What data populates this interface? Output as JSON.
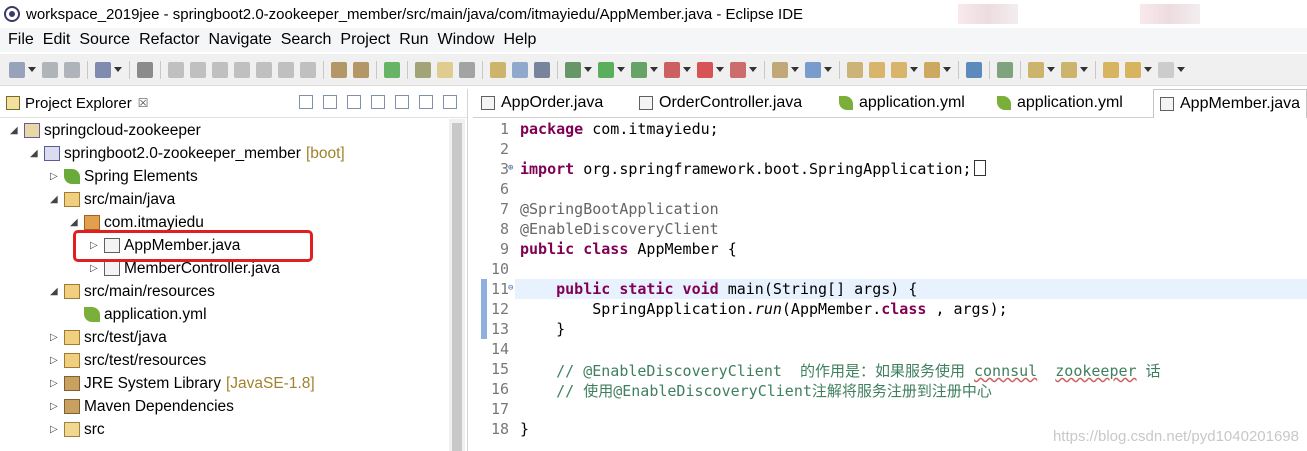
{
  "window": {
    "title": "workspace_2019jee - springboot2.0-zookeeper_member/src/main/java/com/itmayiedu/AppMember.java - Eclipse IDE"
  },
  "menubar": {
    "items": [
      "File",
      "Edit",
      "Source",
      "Refactor",
      "Navigate",
      "Search",
      "Project",
      "Run",
      "Window",
      "Help"
    ]
  },
  "explorer": {
    "title": "Project Explorer",
    "close": "☒",
    "tree": [
      {
        "label": "springcloud-zookeeper",
        "decor": "",
        "depth": 0,
        "twisty": "expanded",
        "icon": "project-icon"
      },
      {
        "label": "springboot2.0-zookeeper_member",
        "decor": "[boot]",
        "depth": 1,
        "twisty": "expanded",
        "icon": "maven-project-icon"
      },
      {
        "label": "Spring Elements",
        "decor": "",
        "depth": 2,
        "twisty": "collapsed",
        "icon": "spring-leaf-icon"
      },
      {
        "label": "src/main/java",
        "decor": "",
        "depth": 2,
        "twisty": "expanded",
        "icon": "source-folder-icon"
      },
      {
        "label": "com.itmayiedu",
        "decor": "",
        "depth": 3,
        "twisty": "expanded",
        "icon": "package-icon"
      },
      {
        "label": "AppMember.java",
        "decor": "",
        "depth": 4,
        "twisty": "collapsed",
        "icon": "java-file-icon"
      },
      {
        "label": "MemberController.java",
        "decor": "",
        "depth": 4,
        "twisty": "collapsed",
        "icon": "java-file-icon"
      },
      {
        "label": "src/main/resources",
        "decor": "",
        "depth": 2,
        "twisty": "expanded",
        "icon": "source-folder-icon"
      },
      {
        "label": "application.yml",
        "decor": "",
        "depth": 3,
        "twisty": "none",
        "icon": "yml-file-icon"
      },
      {
        "label": "src/test/java",
        "decor": "",
        "depth": 2,
        "twisty": "collapsed",
        "icon": "source-folder-icon"
      },
      {
        "label": "src/test/resources",
        "decor": "",
        "depth": 2,
        "twisty": "collapsed",
        "icon": "source-folder-icon"
      },
      {
        "label": "JRE System Library",
        "decor": "[JavaSE-1.8]",
        "depth": 2,
        "twisty": "collapsed",
        "icon": "library-icon"
      },
      {
        "label": "Maven Dependencies",
        "decor": "",
        "depth": 2,
        "twisty": "collapsed",
        "icon": "library-icon"
      },
      {
        "label": "src",
        "decor": "",
        "depth": 2,
        "twisty": "collapsed",
        "icon": "folder-icon"
      }
    ]
  },
  "editor": {
    "tabs": [
      {
        "label": "AppOrder.java",
        "icon": "java-file-icon",
        "active": false
      },
      {
        "label": "OrderController.java",
        "icon": "java-file-icon",
        "active": false
      },
      {
        "label": "application.yml",
        "icon": "yml-file-icon",
        "active": false
      },
      {
        "label": "application.yml",
        "icon": "yml-file-icon",
        "active": false
      },
      {
        "label": "AppMember.java",
        "icon": "java-file-icon",
        "active": true
      }
    ],
    "lines": [
      {
        "n": "1",
        "segs": [
          [
            "kw",
            "package"
          ],
          [
            "",
            "com.itmayiedu;"
          ]
        ]
      },
      {
        "n": "2",
        "segs": []
      },
      {
        "n": "3",
        "segs": [
          [
            "kw",
            "import"
          ],
          [
            "",
            "org.springframework.boot.SpringApplication;"
          ]
        ],
        "fold": true,
        "box": true
      },
      {
        "n": "6",
        "segs": []
      },
      {
        "n": "7",
        "segs": [
          [
            "an",
            "@SpringBootApplication"
          ]
        ]
      },
      {
        "n": "8",
        "segs": [
          [
            "an",
            "@EnableDiscoveryClient"
          ]
        ]
      },
      {
        "n": "9",
        "segs": [
          [
            "kw",
            "public class"
          ],
          [
            "",
            "AppMember {"
          ]
        ]
      },
      {
        "n": "10",
        "segs": []
      },
      {
        "n": "11",
        "segs": [
          [
            "",
            "    "
          ],
          [
            "kw",
            "public static void"
          ],
          [
            "",
            " main(String[] args) {"
          ]
        ],
        "fold": true
      },
      {
        "n": "12",
        "segs": [
          [
            "",
            "        SpringApplication."
          ],
          [
            "it",
            "run"
          ],
          [
            "",
            "(AppMember."
          ],
          [
            "kw",
            "class"
          ],
          [
            "",
            ", args);"
          ]
        ]
      },
      {
        "n": "13",
        "segs": [
          [
            "",
            "    }"
          ]
        ]
      },
      {
        "n": "14",
        "segs": []
      },
      {
        "n": "15",
        "segs": [
          [
            "cm",
            "    // @EnableDiscoveryClient  的作用是：如果服务使用 "
          ],
          [
            "cmsq",
            "connsul"
          ],
          [
            "cm",
            "  "
          ],
          [
            "cmsq",
            "zookeeper"
          ],
          [
            "cm",
            " 话"
          ]
        ]
      },
      {
        "n": "16",
        "segs": [
          [
            "cm",
            "    // 使用@EnableDiscoveryClient注解将服务注册到注册中心"
          ]
        ]
      },
      {
        "n": "17",
        "segs": []
      },
      {
        "n": "18",
        "segs": [
          [
            "",
            "}"
          ]
        ]
      }
    ]
  },
  "watermark": "https://blog.csdn.net/pyd1040201698"
}
